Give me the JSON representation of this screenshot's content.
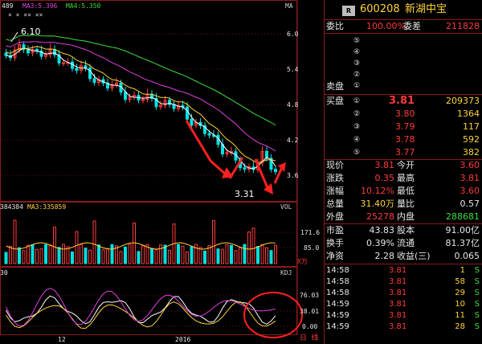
{
  "stock": {
    "badge": "R",
    "code": "600208",
    "name": "新湖中宝"
  },
  "ma_legend": {
    "ma_prev": "489",
    "ma3": "MA3:5.396",
    "ma4": "MA4:5.350",
    "marks": "×   ×   ××   ××",
    "label": "MA"
  },
  "price_axis": [
    "6.0",
    "5.4",
    "4.8",
    "4.2",
    "3.6"
  ],
  "annotations": {
    "high": "6.10",
    "low": "3.31"
  },
  "volume": {
    "legend_left": "384384",
    "legend_ma3": "MA3:335859",
    "label": "VOL",
    "axis": [
      "171.6",
      "85.0"
    ],
    "unit": "X万"
  },
  "kdj": {
    "legend_left": "30",
    "label": "KDJ",
    "axis": [
      "76.03",
      "38.01",
      "0.00"
    ]
  },
  "x_axis": {
    "labels": [
      "12",
      "2016"
    ],
    "corner": "日 线"
  },
  "quote": {
    "weibi_label": "委比",
    "weibi": "100.00%",
    "weicha_label": "委差",
    "weicha": "211828",
    "sell_label": "卖盘",
    "buy_label": "买盘",
    "sell_levels": [
      "⑤",
      "④",
      "③",
      "②",
      "①"
    ],
    "buy": [
      {
        "lvl": "①",
        "price": "3.81",
        "vol": "209373"
      },
      {
        "lvl": "②",
        "price": "3.80",
        "vol": "1364"
      },
      {
        "lvl": "③",
        "price": "3.79",
        "vol": "117"
      },
      {
        "lvl": "④",
        "price": "3.78",
        "vol": "592"
      },
      {
        "lvl": "⑤",
        "price": "3.77",
        "vol": "382"
      }
    ],
    "stats": [
      {
        "l1": "现价",
        "v1": "3.81",
        "c1": "red",
        "l2": "今开",
        "v2": "3.60",
        "c2": "red"
      },
      {
        "l1": "涨跌",
        "v1": "0.35",
        "c1": "red",
        "l2": "最高",
        "v2": "3.81",
        "c2": "red"
      },
      {
        "l1": "涨幅",
        "v1": "10.12%",
        "c1": "red",
        "l2": "最低",
        "v2": "3.60",
        "c2": "red"
      },
      {
        "l1": "总量",
        "v1": "31.40万",
        "c1": "yel",
        "l2": "量比",
        "v2": "0.57",
        "c2": "wht"
      },
      {
        "l1": "外盘",
        "v1": "25278",
        "c1": "red",
        "l2": "内盘",
        "v2": "288681",
        "c2": "green"
      }
    ],
    "fin": [
      {
        "l1": "市盈",
        "v1": "43.83",
        "l2": "股本",
        "v2": "91.00亿"
      },
      {
        "l1": "换手",
        "v1": "0.39%",
        "l2": "流通",
        "v2": "81.37亿"
      },
      {
        "l1": "净资",
        "v1": "2.28",
        "l2": "收益(三)",
        "v2": "0.065"
      }
    ],
    "ticks": [
      {
        "time": "14:58",
        "price": "3.81",
        "vol": "1",
        "side": "S"
      },
      {
        "time": "14:58",
        "price": "3.81",
        "vol": "58",
        "side": "S"
      },
      {
        "time": "14:58",
        "price": "3.81",
        "vol": "29",
        "side": "S"
      },
      {
        "time": "14:59",
        "price": "3.81",
        "vol": "10",
        "side": "S"
      },
      {
        "time": "14:59",
        "price": "3.81",
        "vol": "11",
        "side": "S"
      },
      {
        "time": "14:59",
        "price": "3.81",
        "vol": "28",
        "side": "S"
      }
    ]
  },
  "colors": {
    "up": "#ff3b3b",
    "down": "#00e0e0",
    "ma_white": "#ffffff",
    "ma_yellow": "#ffd23c",
    "ma_magenta": "#e040e0",
    "ma_green": "#3cdc3c",
    "frame": "#8b1a1a",
    "circle": "#ff2020"
  }
}
